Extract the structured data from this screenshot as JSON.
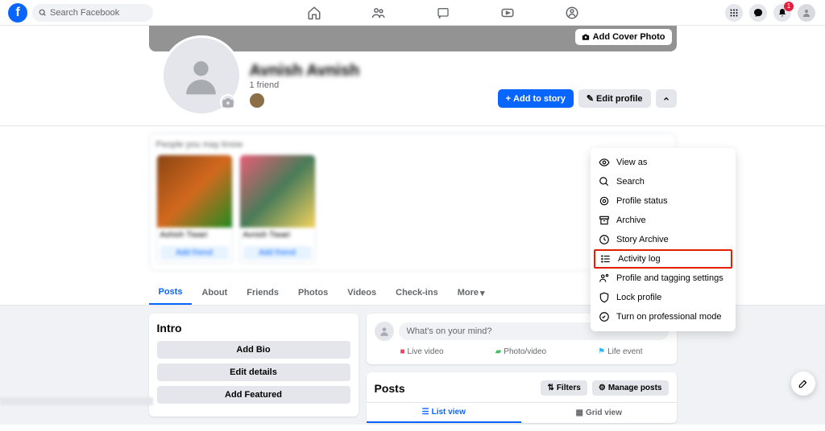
{
  "topnav": {
    "search_placeholder": "Search Facebook",
    "notifications_count": "1"
  },
  "cover": {
    "add_cover_label": "Add Cover Photo"
  },
  "profile": {
    "name": "Avnish Avnish",
    "friends_text": "1 friend",
    "add_story_label": "Add to story",
    "edit_profile_label": "Edit profile"
  },
  "suggestions": {
    "title": "People you may know",
    "cards": [
      {
        "name": "Ashish Tiwari",
        "btn": "Add friend"
      },
      {
        "name": "Avnish Tiwari",
        "btn": "Add friend"
      }
    ]
  },
  "dropdown": {
    "items": [
      {
        "icon": "eye",
        "label": "View as"
      },
      {
        "icon": "search",
        "label": "Search"
      },
      {
        "icon": "badge",
        "label": "Profile status"
      },
      {
        "icon": "archive",
        "label": "Archive"
      },
      {
        "icon": "clock",
        "label": "Story Archive"
      },
      {
        "icon": "list",
        "label": "Activity log",
        "highlight": true
      },
      {
        "icon": "tag",
        "label": "Profile and tagging settings"
      },
      {
        "icon": "shield",
        "label": "Lock profile"
      },
      {
        "icon": "pro",
        "label": "Turn on professional mode"
      }
    ]
  },
  "tabs": {
    "items": [
      "Posts",
      "About",
      "Friends",
      "Photos",
      "Videos",
      "Check-ins",
      "More"
    ]
  },
  "intro": {
    "title": "Intro",
    "buttons": [
      "Add Bio",
      "Edit details",
      "Add Featured"
    ]
  },
  "composer": {
    "placeholder": "What's on your mind?",
    "options": [
      {
        "color": "#f3425f",
        "label": "Live video"
      },
      {
        "color": "#45bd62",
        "label": "Photo/video"
      },
      {
        "color": "#29b4ff",
        "label": "Life event"
      }
    ]
  },
  "posts": {
    "title": "Posts",
    "filters_label": "Filters",
    "manage_label": "Manage posts",
    "list_view": "List view",
    "grid_view": "Grid view"
  }
}
